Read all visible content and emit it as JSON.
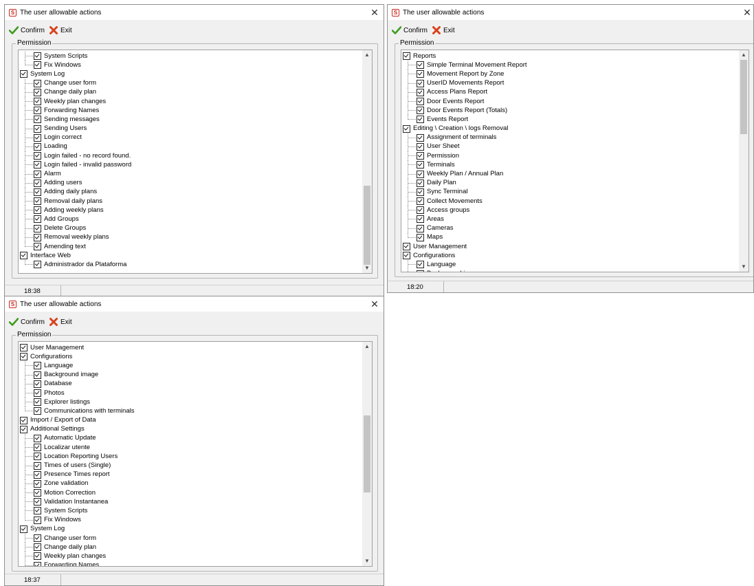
{
  "windows": [
    {
      "title": "The user allowable actions",
      "toolbar": {
        "confirm_label": "Confirm",
        "exit_label": "Exit"
      },
      "group_title": "Permission",
      "status_time": "18:38",
      "tree": [
        {
          "label": "System Scripts",
          "level": 1
        },
        {
          "label": "Fix Windows",
          "level": 1,
          "last": true
        },
        {
          "label": "System Log",
          "level": 0
        },
        {
          "label": "Change user form",
          "level": 1
        },
        {
          "label": "Change daily plan",
          "level": 1
        },
        {
          "label": "Weekly plan changes",
          "level": 1
        },
        {
          "label": "Forwarding Names",
          "level": 1
        },
        {
          "label": "Sending messages",
          "level": 1
        },
        {
          "label": "Sending Users",
          "level": 1
        },
        {
          "label": "Login correct",
          "level": 1
        },
        {
          "label": "Loading",
          "level": 1
        },
        {
          "label": "Login failed - no record found.",
          "level": 1
        },
        {
          "label": "Login failed - invalid password",
          "level": 1
        },
        {
          "label": "Alarm",
          "level": 1
        },
        {
          "label": "Adding users",
          "level": 1
        },
        {
          "label": "Adding daily plans",
          "level": 1
        },
        {
          "label": "Removal daily plans",
          "level": 1
        },
        {
          "label": "Adding weekly plans",
          "level": 1
        },
        {
          "label": "Add Groups",
          "level": 1
        },
        {
          "label": "Delete Groups",
          "level": 1
        },
        {
          "label": "Removal weekly plans",
          "level": 1
        },
        {
          "label": "Amending text",
          "level": 1,
          "last": true
        },
        {
          "label": "Interface Web",
          "level": 0
        },
        {
          "label": "Administrador da Plataforma",
          "level": 1,
          "last": true
        }
      ]
    },
    {
      "title": "The user allowable actions",
      "toolbar": {
        "confirm_label": "Confirm",
        "exit_label": "Exit"
      },
      "group_title": "Permission",
      "status_time": "18:20",
      "tree": [
        {
          "label": "Reports",
          "level": 0
        },
        {
          "label": "Simple Terminal Movement Report",
          "level": 1
        },
        {
          "label": "Movement Report by Zone",
          "level": 1
        },
        {
          "label": "UserID Movements Report",
          "level": 1
        },
        {
          "label": "Access Plans Report",
          "level": 1
        },
        {
          "label": "Door Events Report",
          "level": 1
        },
        {
          "label": "Door Events Report (Totals)",
          "level": 1
        },
        {
          "label": "Events Report",
          "level": 1,
          "last": true
        },
        {
          "label": "Editing \\ Creation \\ logs Removal",
          "level": 0
        },
        {
          "label": "Assignment of terminals",
          "level": 1
        },
        {
          "label": "User Sheet",
          "level": 1
        },
        {
          "label": "Permission",
          "level": 1
        },
        {
          "label": "Terminals",
          "level": 1
        },
        {
          "label": "Weekly Plan / Annual Plan",
          "level": 1
        },
        {
          "label": "Daily Plan",
          "level": 1
        },
        {
          "label": "Sync Terminal",
          "level": 1
        },
        {
          "label": "Collect Movements",
          "level": 1
        },
        {
          "label": "Access groups",
          "level": 1
        },
        {
          "label": "Areas",
          "level": 1
        },
        {
          "label": "Cameras",
          "level": 1
        },
        {
          "label": "Maps",
          "level": 1,
          "last": true
        },
        {
          "label": "User Management",
          "level": 0
        },
        {
          "label": "Configurations",
          "level": 0
        },
        {
          "label": "Language",
          "level": 1
        },
        {
          "label": "Background image",
          "level": 1
        }
      ]
    },
    {
      "title": "The user allowable actions",
      "toolbar": {
        "confirm_label": "Confirm",
        "exit_label": "Exit"
      },
      "group_title": "Permission",
      "status_time": "18:37",
      "tree": [
        {
          "label": "User Management",
          "level": 0
        },
        {
          "label": "Configurations",
          "level": 0
        },
        {
          "label": "Language",
          "level": 1
        },
        {
          "label": "Background image",
          "level": 1
        },
        {
          "label": "Database",
          "level": 1
        },
        {
          "label": "Photos",
          "level": 1
        },
        {
          "label": "Explorer listings",
          "level": 1
        },
        {
          "label": "Communications with terminals",
          "level": 1,
          "last": true
        },
        {
          "label": "Import / Export of Data",
          "level": 0
        },
        {
          "label": "Additional Settings",
          "level": 0
        },
        {
          "label": "Automatic Update",
          "level": 1
        },
        {
          "label": "Localizar utente",
          "level": 1
        },
        {
          "label": "Location Reporting Users",
          "level": 1
        },
        {
          "label": "Times of users (Single)",
          "level": 1
        },
        {
          "label": "Presence Times report",
          "level": 1
        },
        {
          "label": "Zone validation",
          "level": 1
        },
        {
          "label": "Motion Correction",
          "level": 1
        },
        {
          "label": "Validation Instantanea",
          "level": 1
        },
        {
          "label": "System Scripts",
          "level": 1
        },
        {
          "label": "Fix Windows",
          "level": 1,
          "last": true
        },
        {
          "label": "System Log",
          "level": 0
        },
        {
          "label": "Change user form",
          "level": 1
        },
        {
          "label": "Change daily plan",
          "level": 1
        },
        {
          "label": "Weekly plan changes",
          "level": 1
        },
        {
          "label": "Forwarding Names",
          "level": 1
        }
      ]
    }
  ]
}
